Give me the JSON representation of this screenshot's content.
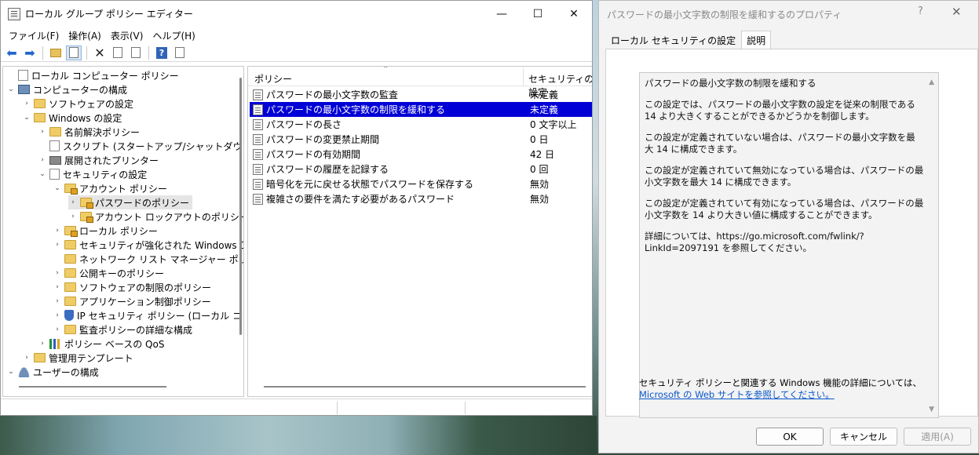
{
  "main_window": {
    "title": "ローカル グループ ポリシー エディター",
    "controls": {
      "minimize": "—",
      "maximize": "☐",
      "close": "✕"
    },
    "menu": [
      "ファイル(F)",
      "操作(A)",
      "表示(V)",
      "ヘルプ(H)"
    ],
    "tree": [
      {
        "label": "ローカル コンピューター ポリシー",
        "icon": "doc-icon",
        "chev": ""
      },
      {
        "label": "コンピューターの構成",
        "icon": "computer-icon",
        "chev": "⌄"
      },
      {
        "label": "ソフトウェアの設定",
        "icon": "folder-icon",
        "chev": "›"
      },
      {
        "label": "Windows の設定",
        "icon": "folder-icon",
        "chev": "⌄"
      },
      {
        "label": "名前解決ポリシー",
        "icon": "folder-icon",
        "chev": "›"
      },
      {
        "label": "スクリプト (スタートアップ/シャットダウン)",
        "icon": "doc-icon",
        "chev": ""
      },
      {
        "label": "展開されたプリンター",
        "icon": "printer-icon",
        "chev": "›"
      },
      {
        "label": "セキュリティの設定",
        "icon": "doc-icon",
        "chev": "⌄"
      },
      {
        "label": "アカウント ポリシー",
        "icon": "lock-folder-icon",
        "chev": "⌄"
      },
      {
        "label": "パスワードのポリシー",
        "icon": "lock-folder-icon",
        "chev": "›",
        "selected": true
      },
      {
        "label": "アカウント ロックアウトのポリシー",
        "icon": "lock-folder-icon",
        "chev": "›"
      },
      {
        "label": "ローカル ポリシー",
        "icon": "lock-folder-icon",
        "chev": "›"
      },
      {
        "label": "セキュリティが強化された Windows Defe",
        "icon": "folder-icon",
        "chev": "›"
      },
      {
        "label": "ネットワーク リスト マネージャー ポリシー",
        "icon": "folder-icon",
        "chev": ""
      },
      {
        "label": "公開キーのポリシー",
        "icon": "folder-icon",
        "chev": "›"
      },
      {
        "label": "ソフトウェアの制限のポリシー",
        "icon": "folder-icon",
        "chev": "›"
      },
      {
        "label": "アプリケーション制御ポリシー",
        "icon": "folder-icon",
        "chev": "›"
      },
      {
        "label": "IP セキュリティ ポリシー (ローカル コンピュー",
        "icon": "shield-icon",
        "chev": "›"
      },
      {
        "label": "監査ポリシーの詳細な構成",
        "icon": "folder-icon",
        "chev": "›"
      },
      {
        "label": "ポリシー ベースの QoS",
        "icon": "qos-icon",
        "chev": "›"
      },
      {
        "label": "管理用テンプレート",
        "icon": "folder-icon",
        "chev": "›"
      },
      {
        "label": "ユーザーの構成",
        "icon": "user-icon",
        "chev": "⌄"
      }
    ],
    "list_header": {
      "policy": "ポリシー",
      "setting": "セキュリティの設定"
    },
    "policies": [
      {
        "name": "パスワードの最小文字数の監査",
        "value": "未定義"
      },
      {
        "name": "パスワードの最小文字数の制限を緩和する",
        "value": "未定義",
        "selected": true
      },
      {
        "name": "パスワードの長さ",
        "value": "0 文字以上"
      },
      {
        "name": "パスワードの変更禁止期間",
        "value": "0 日"
      },
      {
        "name": "パスワードの有効期間",
        "value": "42 日"
      },
      {
        "name": "パスワードの履歴を記録する",
        "value": "0 回"
      },
      {
        "name": "暗号化を元に戻せる状態でパスワードを保存する",
        "value": "無効"
      },
      {
        "name": "複雑さの要件を満たす必要があるパスワード",
        "value": "無効"
      }
    ]
  },
  "dialog": {
    "title": "パスワードの最小文字数の制限を緩和するのプロパティ",
    "help": "?",
    "close": "✕",
    "tabs": [
      "ローカル セキュリティの設定",
      "説明"
    ],
    "explain": [
      "パスワードの最小文字数の制限を緩和する",
      "この設定では、パスワードの最小文字数の設定を従来の制限である 14 より大きくすることができるかどうかを制御します。",
      "この設定が定義されていない場合は、パスワードの最小文字数を最大 14 に構成できます。",
      "この設定が定義されていて無効になっている場合は、パスワードの最小文字数を最大 14 に構成できます。",
      "この設定が定義されていて有効になっている場合は、パスワードの最小文字数を 14 より大きい値に構成することができます。",
      "詳細については、https://go.microsoft.com/fwlink/?LinkId=2097191 を参照してください。"
    ],
    "note_text": "セキュリティ ポリシーと関連する Windows 機能の詳細については、",
    "note_link": "Microsoft の Web サイトを参照してください。",
    "buttons": {
      "ok": "OK",
      "cancel": "キャンセル",
      "apply": "適用(A)"
    }
  }
}
